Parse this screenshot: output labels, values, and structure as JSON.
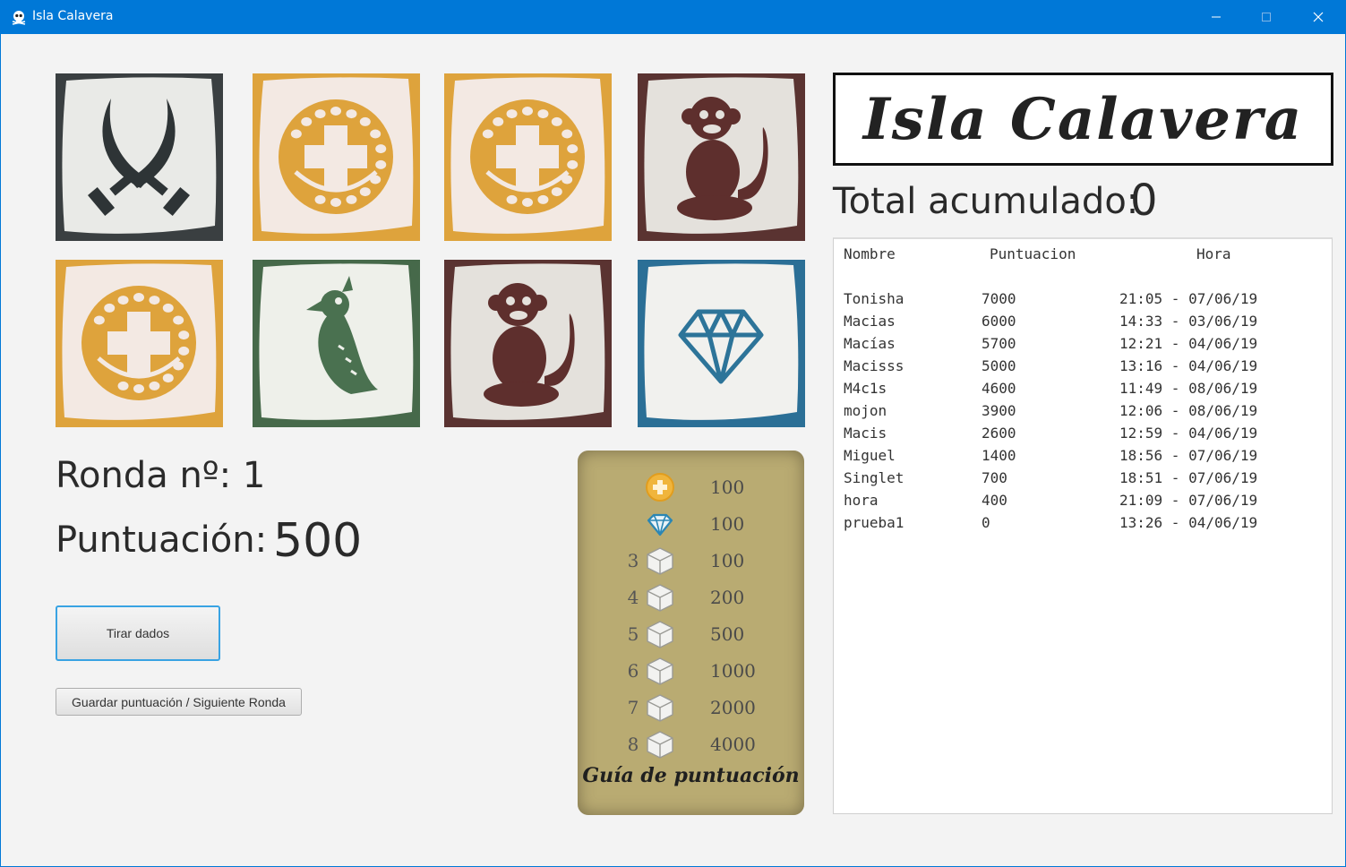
{
  "window": {
    "title": "Isla Calavera"
  },
  "dice": [
    {
      "face": "swords",
      "bg": "#3a3f41",
      "fg": "#2e3436",
      "tile": "#e9eae7"
    },
    {
      "face": "coin",
      "bg": "#dea33c",
      "fg": "#dea33c",
      "tile": "#f3e9e3"
    },
    {
      "face": "coin",
      "bg": "#dea33c",
      "fg": "#dea33c",
      "tile": "#f3e9e3"
    },
    {
      "face": "monkey",
      "bg": "#5a3331",
      "fg": "#5e2f2d",
      "tile": "#e4e1dc"
    },
    {
      "face": "coin",
      "bg": "#dea33c",
      "fg": "#dea33c",
      "tile": "#f3e9e3"
    },
    {
      "face": "parrot",
      "bg": "#46694a",
      "fg": "#4a7150",
      "tile": "#eef0ea"
    },
    {
      "face": "monkey",
      "bg": "#5a3331",
      "fg": "#5e2f2d",
      "tile": "#e4e1dc"
    },
    {
      "face": "diamond",
      "bg": "#2b6f96",
      "fg": "#2d7499",
      "tile": "#f1f1ee"
    }
  ],
  "round": {
    "label": "Ronda nº: 1"
  },
  "score": {
    "label": "Puntuación:",
    "value": "500"
  },
  "buttons": {
    "roll": "Tirar dados",
    "save": "Guardar puntuación / Siguiente Ronda"
  },
  "guide": {
    "title": "Guía de puntuación",
    "rows": [
      {
        "count": "",
        "icon": "coin-icon",
        "points": "100"
      },
      {
        "count": "",
        "icon": "diamond-icon",
        "points": "100"
      },
      {
        "count": "3",
        "icon": "die-icon",
        "points": "100"
      },
      {
        "count": "4",
        "icon": "die-icon",
        "points": "200"
      },
      {
        "count": "5",
        "icon": "die-icon",
        "points": "500"
      },
      {
        "count": "6",
        "icon": "die-icon",
        "points": "1000"
      },
      {
        "count": "7",
        "icon": "die-icon",
        "points": "2000"
      },
      {
        "count": "8",
        "icon": "die-icon",
        "points": "4000"
      }
    ]
  },
  "logo": {
    "text": "Isla Calavera"
  },
  "total": {
    "label": "Total acumulado:",
    "value": "0"
  },
  "table": {
    "headers": [
      "Nombre",
      "Puntuacion",
      "Hora"
    ],
    "rows": [
      [
        "Tonisha",
        "7000",
        "21:05 - 07/06/19"
      ],
      [
        "Macias",
        "6000",
        "14:33 - 03/06/19"
      ],
      [
        "Macías",
        "5700",
        "12:21 - 04/06/19"
      ],
      [
        "Macisss",
        "5000",
        "13:16 - 04/06/19"
      ],
      [
        "M4c1s",
        "4600",
        "11:49 - 08/06/19"
      ],
      [
        "mojon",
        "3900",
        "12:06 - 08/06/19"
      ],
      [
        "Macis",
        "2600",
        "12:59 - 04/06/19"
      ],
      [
        "Miguel",
        "1400",
        "18:56 - 07/06/19"
      ],
      [
        "Singlet",
        "700",
        "18:51 - 07/06/19"
      ],
      [
        "hora",
        "400",
        "21:09 - 07/06/19"
      ],
      [
        "prueba1",
        "0",
        "13:26 - 04/06/19"
      ]
    ]
  }
}
